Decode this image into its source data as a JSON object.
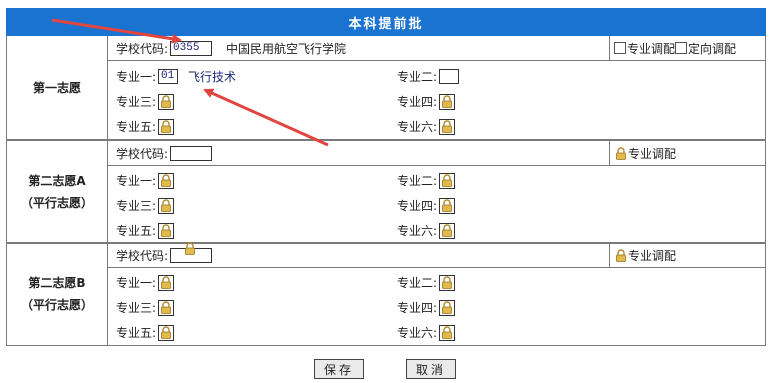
{
  "header": {
    "title": "本科提前批"
  },
  "choice1": {
    "label": "第一志愿",
    "school_code_label": "学校代码:",
    "school_code": "0355",
    "school_name": "中国民用航空飞行学院",
    "adjust_major": "专业调配",
    "adjust_direction": "定向调配",
    "majors": [
      {
        "label": "专业一:",
        "code": "01",
        "name": "飞行技术",
        "state": "filled"
      },
      {
        "label": "专业二:",
        "state": "empty"
      },
      {
        "label": "专业三:",
        "state": "locked"
      },
      {
        "label": "专业四:",
        "state": "locked"
      },
      {
        "label": "专业五:",
        "state": "locked"
      },
      {
        "label": "专业六:",
        "state": "locked"
      }
    ]
  },
  "choice2a": {
    "label_line1": "第二志愿A",
    "label_line2": "（平行志愿）",
    "school_code_label": "学校代码:",
    "adjust_major": "专业调配",
    "majors": [
      {
        "label": "专业一:"
      },
      {
        "label": "专业二:"
      },
      {
        "label": "专业三:"
      },
      {
        "label": "专业四:"
      },
      {
        "label": "专业五:"
      },
      {
        "label": "专业六:"
      }
    ]
  },
  "choice2b": {
    "label_line1": "第二志愿B",
    "label_line2": "（平行志愿）",
    "school_code_label": "学校代码:",
    "adjust_major": "专业调配",
    "majors": [
      {
        "label": "专业一:"
      },
      {
        "label": "专业二:"
      },
      {
        "label": "专业三:"
      },
      {
        "label": "专业四:"
      },
      {
        "label": "专业五:"
      },
      {
        "label": "专业六:"
      }
    ]
  },
  "buttons": {
    "save": "保存",
    "cancel": "取消"
  },
  "colors": {
    "header_bg": "#1a73d0",
    "arrow": "#e0453f"
  }
}
